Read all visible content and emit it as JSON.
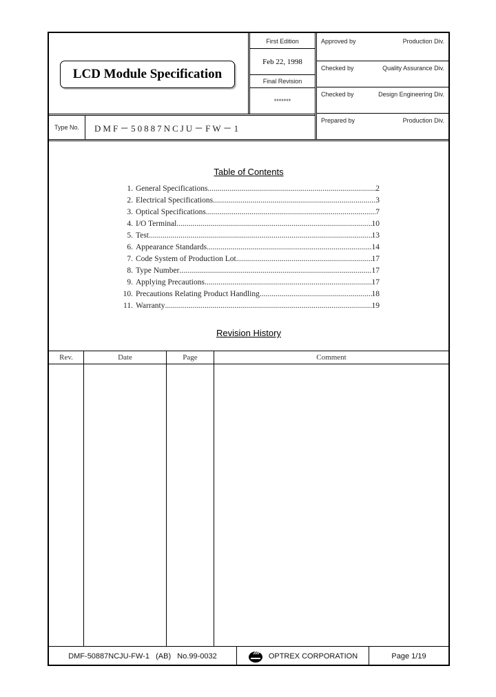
{
  "header": {
    "title": "LCD Module Specification",
    "first_edition_label": "First Edition",
    "first_edition_date": "Feb 22, 1998",
    "final_revision_label": "Final Revision",
    "final_revision_value": "*******",
    "type_no_label": "Type No.",
    "type_no_value": "DMF－50887NCJU－FW－1",
    "approvals": [
      {
        "role": "Approved by",
        "division": "Production Div."
      },
      {
        "role": "Checked by",
        "division": "Quality Assurance Div."
      },
      {
        "role": "Checked by",
        "division": "Design Engineering Div."
      },
      {
        "role": "Prepared by",
        "division": "Production Div."
      }
    ]
  },
  "toc": {
    "title": "Table of Contents",
    "items": [
      {
        "num": "1.",
        "label": "General  Specifications",
        "page": "2"
      },
      {
        "num": "2.",
        "label": "Electrical  Specifications",
        "page": "3"
      },
      {
        "num": "3.",
        "label": "Optical  Specifications",
        "page": "7"
      },
      {
        "num": "4.",
        "label": "I/O  Terminal",
        "page": "10"
      },
      {
        "num": "5.",
        "label": "Test",
        "page": "13"
      },
      {
        "num": "6.",
        "label": "Appearance  Standards",
        "page": "14"
      },
      {
        "num": "7.",
        "label": "Code  System  of  Production  Lot",
        "page": "17"
      },
      {
        "num": "8.",
        "label": "Type  Number",
        "page": "17"
      },
      {
        "num": "9.",
        "label": "Applying  Precautions",
        "page": "17"
      },
      {
        "num": "10.",
        "label": "Precautions  Relating  Product  Handling",
        "page": "18"
      },
      {
        "num": "11.",
        "label": "Warranty",
        "page": "19"
      }
    ]
  },
  "revision_history": {
    "title": "Revision History",
    "columns": [
      "Rev.",
      "Date",
      "Page",
      "Comment"
    ],
    "rows": []
  },
  "footer": {
    "doc_id": "DMF-50887NCJU-FW-1   (AB)   No.99-0032",
    "company": "OPTREX CORPORATION",
    "page": "Page 1/19"
  }
}
